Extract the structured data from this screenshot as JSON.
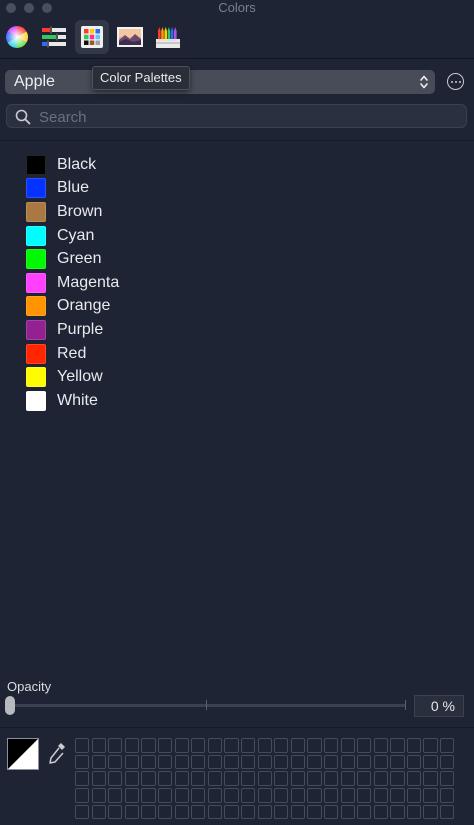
{
  "window": {
    "title": "Colors"
  },
  "toolbar": {
    "tools": [
      {
        "icon": "color-wheel-icon"
      },
      {
        "icon": "color-sliders-icon"
      },
      {
        "icon": "color-palettes-icon",
        "active": true
      },
      {
        "icon": "image-palettes-icon"
      },
      {
        "icon": "pencils-icon"
      }
    ],
    "tooltip": "Color Palettes"
  },
  "palette_select": {
    "value": "Apple"
  },
  "search": {
    "value": "",
    "placeholder": "Search"
  },
  "colors": [
    {
      "name": "Black",
      "hex": "#000000"
    },
    {
      "name": "Blue",
      "hex": "#0433ff"
    },
    {
      "name": "Brown",
      "hex": "#aa7942"
    },
    {
      "name": "Cyan",
      "hex": "#00fdff"
    },
    {
      "name": "Green",
      "hex": "#00f900"
    },
    {
      "name": "Magenta",
      "hex": "#ff40ff"
    },
    {
      "name": "Orange",
      "hex": "#ff9300"
    },
    {
      "name": "Purple",
      "hex": "#942192"
    },
    {
      "name": "Red",
      "hex": "#ff2600"
    },
    {
      "name": "Yellow",
      "hex": "#fffb00"
    },
    {
      "name": "White",
      "hex": "#ffffff"
    }
  ],
  "opacity": {
    "label": "Opacity",
    "value_text": "0 %",
    "value": 0
  },
  "current_color": {
    "hex": "#000000"
  },
  "color_wells": {
    "rows": 5,
    "cols": 23
  }
}
